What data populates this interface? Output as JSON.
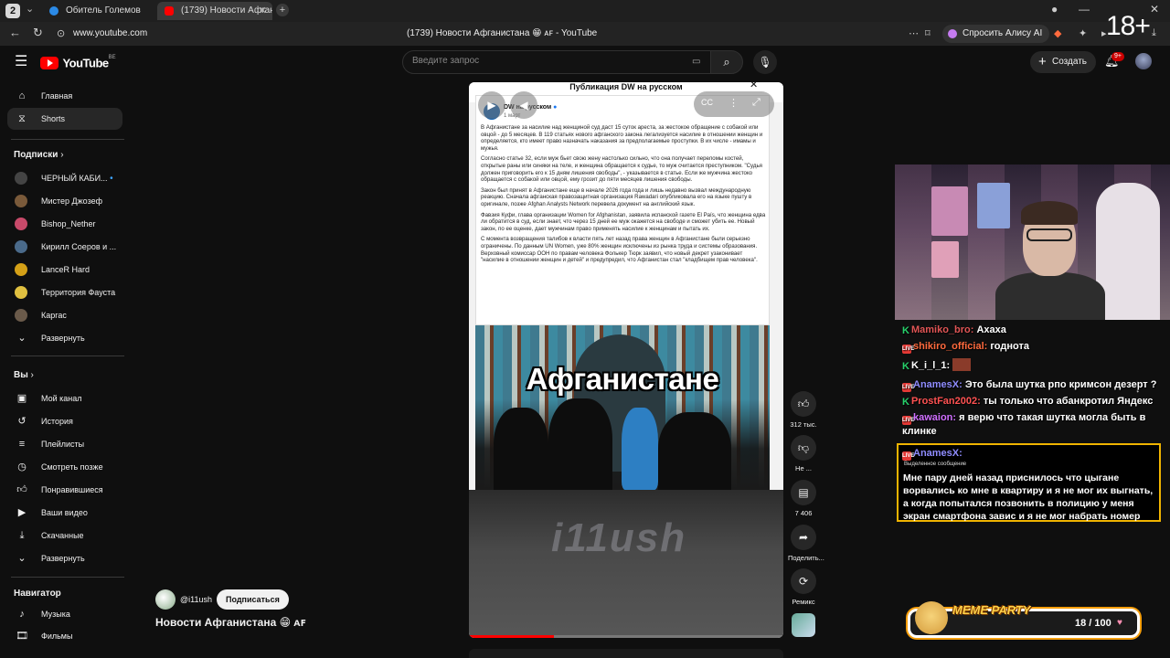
{
  "browser": {
    "tab_count": "2",
    "tabs": [
      {
        "title": "Обитель Големов",
        "color": "#2b8ae6"
      },
      {
        "title": "(1739) Новости Афганистана 😁 AF",
        "color": "#ff0000"
      }
    ],
    "url": "www.youtube.com",
    "page_title": "(1739) Новости Афганистана 😁 ᴀꜰ - YouTube",
    "alice_label": "Спросить Алису AI",
    "age_rating": "18+"
  },
  "header": {
    "logo": "YouTube",
    "region": "BE",
    "search_placeholder": "Введите запрос",
    "create_label": "Создать",
    "notif_count": "9+"
  },
  "sidebar": {
    "main": [
      {
        "label": "Главная",
        "icon": "home-icon"
      },
      {
        "label": "Shorts",
        "icon": "shorts-icon",
        "active": true
      }
    ],
    "subs_title": "Подписки",
    "subs": [
      {
        "label": "ЧЕРНЫЙ КАБИ...",
        "color": "#444"
      },
      {
        "label": "Мистер Джозеф",
        "color": "#7a5a3a"
      },
      {
        "label": "Bishop_Nether",
        "color": "#c84a6a"
      },
      {
        "label": "Кирилл Соеров и ...",
        "color": "#4a6a8a"
      },
      {
        "label": "LanceR Hard",
        "color": "#d4a017"
      },
      {
        "label": "Территория Фауста",
        "color": "#e0c040"
      },
      {
        "label": "Каргас",
        "color": "#6a5a4a"
      },
      {
        "label": "Развернуть",
        "icon": "chevron-down-icon"
      }
    ],
    "you_title": "Вы",
    "you": [
      {
        "label": "Мой канал",
        "icon": "channel-icon"
      },
      {
        "label": "История",
        "icon": "history-icon"
      },
      {
        "label": "Плейлисты",
        "icon": "playlists-icon"
      },
      {
        "label": "Смотреть позже",
        "icon": "watch-later-icon"
      },
      {
        "label": "Понравившиеся",
        "icon": "like-icon"
      },
      {
        "label": "Ваши видео",
        "icon": "your-videos-icon"
      },
      {
        "label": "Скачанные",
        "icon": "download-icon"
      },
      {
        "label": "Развернуть",
        "icon": "chevron-down-icon"
      }
    ],
    "nav_title": "Навигатор",
    "nav": [
      {
        "label": "Музыка",
        "icon": "music-icon"
      },
      {
        "label": "Фильмы",
        "icon": "films-icon"
      }
    ]
  },
  "post": {
    "header": "Публикация DW на русском",
    "author": "DW на русском",
    "date": "1 март",
    "paragraphs": [
      "В Афганистане за насилие над женщиной суд даст 15 суток ареста, за жестокое обращение с собакой или овцой - до 5 месяцев. В 119 статьях нового афганского закона легализуется насилие в отношении женщин и определяется, кто имеет право назначать наказания за предполагаемые проступки. В их числе - имамы и мужья.",
      "Согласно статье 32, если муж бьет свою жену настолько сильно, что она получает переломы костей, открытые раны или синяки на теле, и женщина обращается к судье, то муж считается преступником. \"Судья должен приговорить его к 15 дням лишения свободы\", - указывается в статье. Если же мужчина жестоко обращается с собакой или овцой, ему грозит до пяти месяцев лишения свободы.",
      "Закон был принят в Афганистане еще в начале 2026 года года и лишь недавно вызвал международную реакцию. Сначала афганская правозащитная организация Rawadari опубликовала его на языке пушту в оригинале, позже Afghan Analysts Network перевела документ на английский язык.",
      "Фавзия Куфи, глава организации Women for Afghanistan, заявила испанской газете El País, что женщина едва ли обратится в суд, если знает, что через 15 дней ее муж окажется на свободе и сможет убить ее. Новый закон, по ее оценке, дает мужчинам право применять насилие к женщинам и пытать их.",
      "С момента возвращения талибов к власти пять лет назад права женщин в Афганистане были серьезно ограничены. По данным UN Women, уже 80% женщин исключены из рынка труда и системы образования. Верховный комиссар ООН по правам человека Фолькер Тюрк заявил, что новый декрет узаконивает \"насилие в отношении женщин и детей\" и предупредил, что Афганистан стал \"кладбищем прав человека\"."
    ],
    "photo_caption": "Афганистане",
    "watermark": "i11ush",
    "progress": 0.27
  },
  "actions": {
    "likes": "312 тыс.",
    "dislike": "Не ...",
    "comments": "7 406",
    "share": "Поделить...",
    "remix": "Ремикс"
  },
  "channel": {
    "handle": "@i11ush",
    "subscribe": "Подписаться",
    "video_title": "Новости Афганистана 😁 ᴀꜰ"
  },
  "chat": [
    {
      "user": "Mamiko_bro:",
      "text": "Ахаха",
      "color": "#e05555",
      "badge": "k"
    },
    {
      "user": "shikiro_official:",
      "text": "годнота",
      "color": "#ff6a3d",
      "badge": "live"
    },
    {
      "user": "K_i_l_1:",
      "text": "",
      "color": "#ffffff",
      "badge": "k"
    },
    {
      "user": "AnamesX:",
      "text": "Это была шутка рпо кримсон дезерт ?",
      "color": "#8f8cff",
      "badge": "live"
    },
    {
      "user": "ProstFan2002:",
      "text": "ты только что абанкротил Яндекс",
      "color": "#ff5252",
      "badge": "k"
    },
    {
      "user": "kawaion:",
      "text": "я верю что такая шутка могла быть в клинке",
      "color": "#d070ff",
      "badge": "live"
    }
  ],
  "highlight": {
    "user": "AnamesX:",
    "tag": "Выделенное сообщение",
    "text": "Мне пару дней назад приснилось что цыгане ворвались ко мне в квартиру и я не мог их выгнать, а когда попытался позвонить в полицию у меня экран смартфона завис и я не мог набрать номер"
  },
  "meme": {
    "title": "MEME PARTY",
    "count": "18 / 100"
  }
}
